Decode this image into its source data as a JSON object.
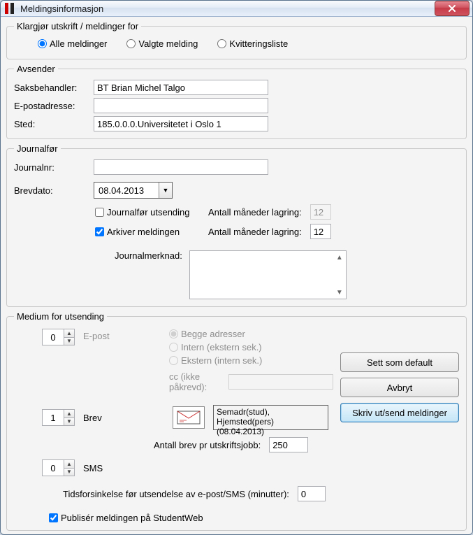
{
  "window": {
    "title": "Meldingsinformasjon",
    "close_label": "x"
  },
  "prepare": {
    "legend": "Klargjør utskrift / meldinger for",
    "opt_all": "Alle meldinger",
    "opt_selected": "Valgte melding",
    "opt_receipt": "Kvitteringsliste"
  },
  "sender": {
    "legend": "Avsender",
    "saksbehandler_label": "Saksbehandler:",
    "saksbehandler_value": "BT Brian Michel Talgo",
    "epost_label": "E-postadresse:",
    "epost_value": "",
    "sted_label": "Sted:",
    "sted_value": "185.0.0.0.Universitetet i Oslo 1"
  },
  "journal": {
    "legend": "Journalfør",
    "journalnr_label": "Journalnr:",
    "journalnr_value": "",
    "brevdato_label": "Brevdato:",
    "brevdato_value": "08.04.2013",
    "journalfor_utsending": "Journalfør utsending",
    "arkiver_meldingen": "Arkiver meldingen",
    "antall_mnd_label": "Antall måneder lagring:",
    "antall_mnd_disabled": "12",
    "antall_mnd_value": "12",
    "merknad_label": "Journalmerknad:"
  },
  "medium": {
    "legend": "Medium for utsending",
    "epost_count": "0",
    "epost_label": "E-post",
    "radio_begge": "Begge adresser",
    "radio_intern": "Intern (ekstern sek.)",
    "radio_ekstern": "Ekstern (intern sek.)",
    "cc_label": "cc (ikke påkrevd):",
    "cc_value": "",
    "brev_count": "1",
    "brev_label": "Brev",
    "sem_line1": "Semadr(stud), Hjemsted(pers)",
    "sem_line2": "(08.04.2013)",
    "antall_brev_label": "Antall brev pr utskriftsjobb:",
    "antall_brev_value": "250",
    "sms_count": "0",
    "sms_label": "SMS",
    "delay_label": "Tidsforsinkelse før utsendelse av e-post/SMS (minutter):",
    "delay_value": "0",
    "publiser_label": "Publisér meldingen på StudentWeb"
  },
  "buttons": {
    "set_default": "Sett som default",
    "cancel": "Avbryt",
    "send": "Skriv ut/send meldinger"
  }
}
